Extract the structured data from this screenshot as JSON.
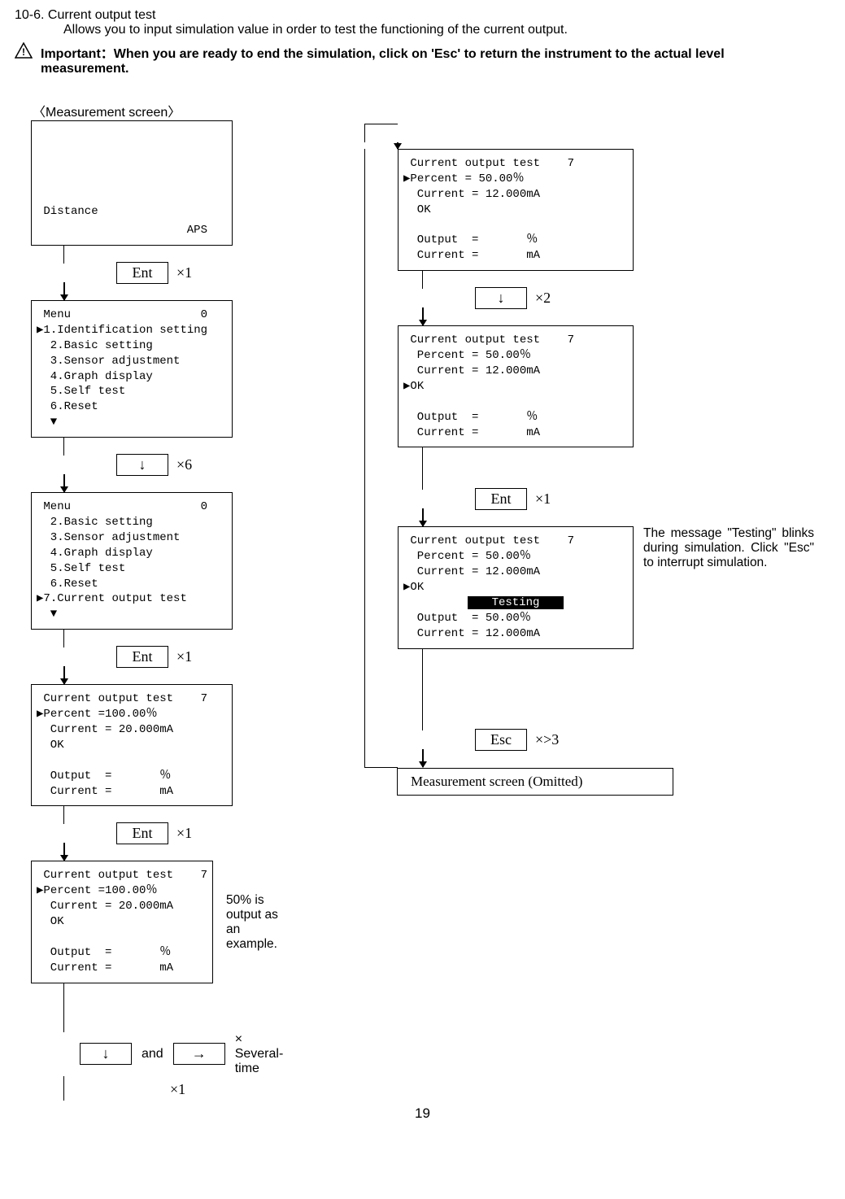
{
  "heading": "10-6. Current output test",
  "intro": "Allows you to input simulation value in order to test the functioning of the current output.",
  "important": "Important：When you are ready to end the simulation, click on 'Esc' to return the instrument to the actual level measurement.",
  "measurement_label": "〈Measurement screen〉",
  "distance_line": " Distance",
  "aps": "APS",
  "buttons": {
    "ent": "Ent",
    "esc": "Esc",
    "down": "↓",
    "arrow": "→"
  },
  "x1": "×1",
  "x2": "×2",
  "x6": "×6",
  "xgt3": "×>3",
  "menu0_title": " Menu                   0",
  "menu0_lines": "▶1.Identification setting\n  2.Basic setting\n  3.Sensor adjustment\n  4.Graph display\n  5.Self test\n  6.Reset\n  ▼",
  "menu0b_title": " Menu                   0",
  "menu0b_lines": "  2.Basic setting\n  3.Sensor adjustment\n  4.Graph display\n  5.Self test\n  6.Reset\n▶7.Current output test\n  ▼",
  "cot1": " Current output test    7\n▶Percent =100.00％\n  Current = 20.000mA\n  OK\n\n  Output  =       ％\n  Current =       mA",
  "cot2": " Current output test    7\n▶Percent =100.00％\n  Current = 20.000mA\n  OK\n\n  Output  =       ％\n  Current =       mA",
  "cotr1": " Current output test    7\n▶Percent = 50.00％\n  Current = 12.000mA\n  OK\n\n  Output  =       ％\n  Current =       mA",
  "cotr2": " Current output test    7\n  Percent = 50.00％\n  Current = 12.000mA\n▶OK\n\n  Output  =       ％\n  Current =       mA",
  "cotr3a": " Current output test    7\n  Percent = 50.00％\n  Current = 12.000mA\n▶OK",
  "cotr3_testing": "Testing",
  "cotr3b": "  Output  = 50.00％\n  Current = 12.000mA",
  "right_note": "The message \"Testing\" blinks during simulation. Click \"Esc\" to interrupt simulation.",
  "example_note": "50% is output as an example.",
  "and": "and",
  "several": "× Several-time",
  "meas_omitted": "Measurement screen (Omitted)",
  "page_num": "19"
}
